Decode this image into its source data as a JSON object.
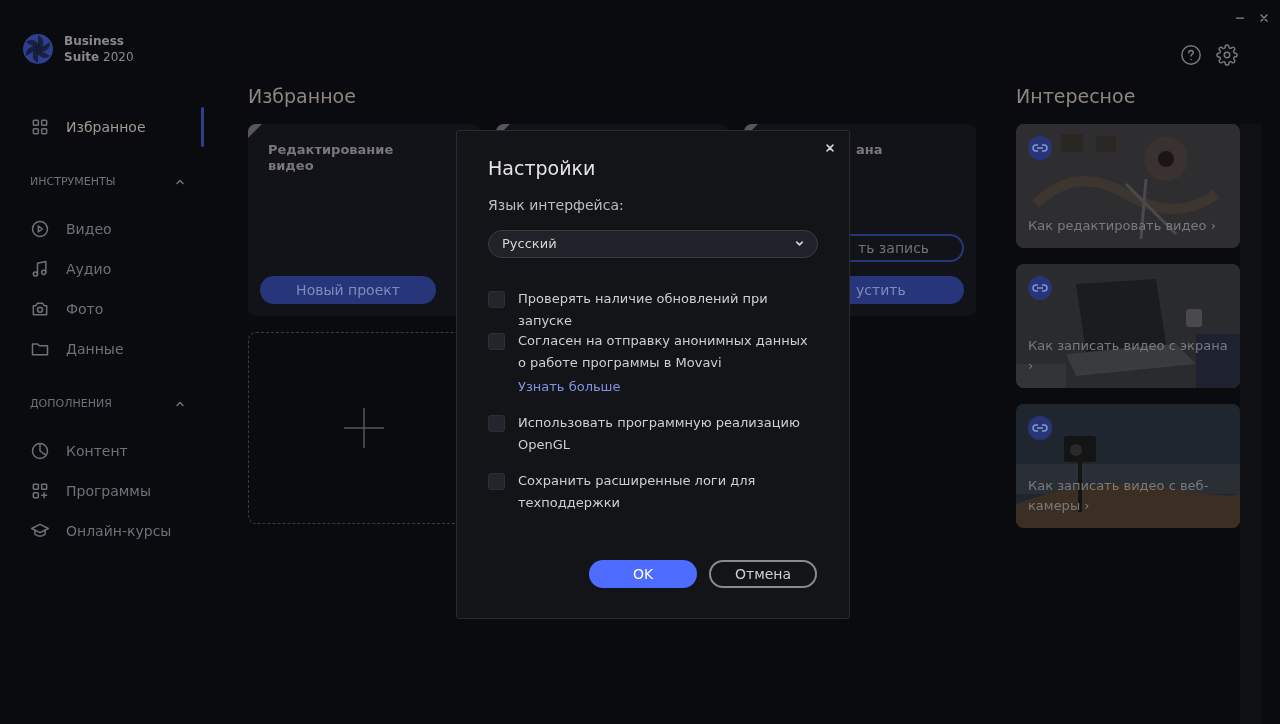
{
  "logo": {
    "title": "Business",
    "subtitle": "**Suite** 2020"
  },
  "sidebar": {
    "top_items": [
      {
        "label": "Избранное",
        "selected": true
      }
    ],
    "sections": [
      {
        "title": "ИНСТРУМЕНТЫ",
        "expanded": true,
        "items": [
          {
            "label": "Видео",
            "selected": false
          },
          {
            "label": "Аудио",
            "selected": false
          },
          {
            "label": "Фото",
            "selected": false
          },
          {
            "label": "Данные",
            "selected": false
          }
        ]
      },
      {
        "title": "ДОПОЛНЕНИЯ",
        "expanded": true,
        "items": [
          {
            "label": "Контент",
            "selected": false
          },
          {
            "label": "Программы",
            "selected": false
          },
          {
            "label": "Онлайн-курсы",
            "selected": false
          }
        ]
      }
    ]
  },
  "favorites": {
    "heading": "Избранное",
    "cards": [
      {
        "title": "Редактирование видео",
        "ribbon": true,
        "buttons": [
          {
            "label": "Новый проект",
            "kind": "filled"
          }
        ]
      },
      {
        "ribbon": true
      },
      {
        "title": "ана",
        "ribbon": true,
        "buttons": [
          {
            "label": "ть запись",
            "kind": "outline"
          },
          {
            "label": "устить",
            "kind": "filled"
          }
        ]
      }
    ]
  },
  "interesting": {
    "heading": "Интересное",
    "articles": [
      {
        "title": "Как редактировать видео ›"
      },
      {
        "title": "Как записать видео с экрана ›"
      },
      {
        "title": "Как записать видео с веб-камеры ›"
      }
    ]
  },
  "dialog": {
    "title": "Настройки",
    "language_label": "Язык интерфейса:",
    "language": "Русский",
    "options": [
      {
        "label": "Проверять наличие обновлений при запуске",
        "checked": false
      },
      {
        "label": "Согласен на отправку анонимных данных о работе программы в Movavi",
        "checked": false,
        "link": "Узнать больше"
      },
      {
        "label": "Использовать программную реализацию OpenGL",
        "checked": false
      },
      {
        "label": "Сохранить расширенные логи для техподдержки",
        "checked": false
      }
    ],
    "buttons": [
      {
        "label": "OK",
        "kind": "primary"
      },
      {
        "label": "Отмена",
        "kind": "secondary"
      }
    ]
  }
}
